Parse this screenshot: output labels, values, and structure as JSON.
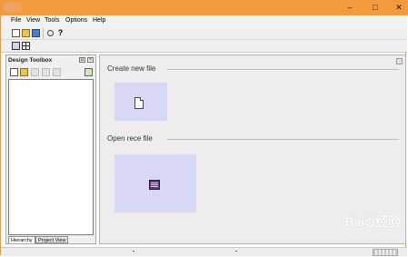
{
  "window": {
    "minimize": "–",
    "maximize": "□",
    "close": "✕"
  },
  "menu": [
    {
      "label": "File"
    },
    {
      "label": "View"
    },
    {
      "label": "Tools"
    },
    {
      "label": "Options"
    },
    {
      "label": "Help"
    }
  ],
  "toolbar": {
    "icons": [
      "new-file-icon",
      "open-folder-icon",
      "open-project-icon",
      "find-icon",
      "help-icon"
    ],
    "help_label": "?"
  },
  "toolbar2": {
    "icons": [
      "layout-icon",
      "grid-icon"
    ]
  },
  "sidebar": {
    "title": "Design Toolbox",
    "pin_glyph": "⊔",
    "close_glyph": "×",
    "tabs": [
      {
        "label": "Hierarchy",
        "active": true
      },
      {
        "label": "Project View",
        "active": false
      }
    ]
  },
  "main": {
    "sections": [
      {
        "title": "Create new file"
      },
      {
        "title": "Open rece    file"
      }
    ]
  },
  "watermark": "Bai⊙经验",
  "colors": {
    "titlebar": "#f29a3d",
    "tile": "#d7d8f6",
    "workspace": "#ededed"
  }
}
